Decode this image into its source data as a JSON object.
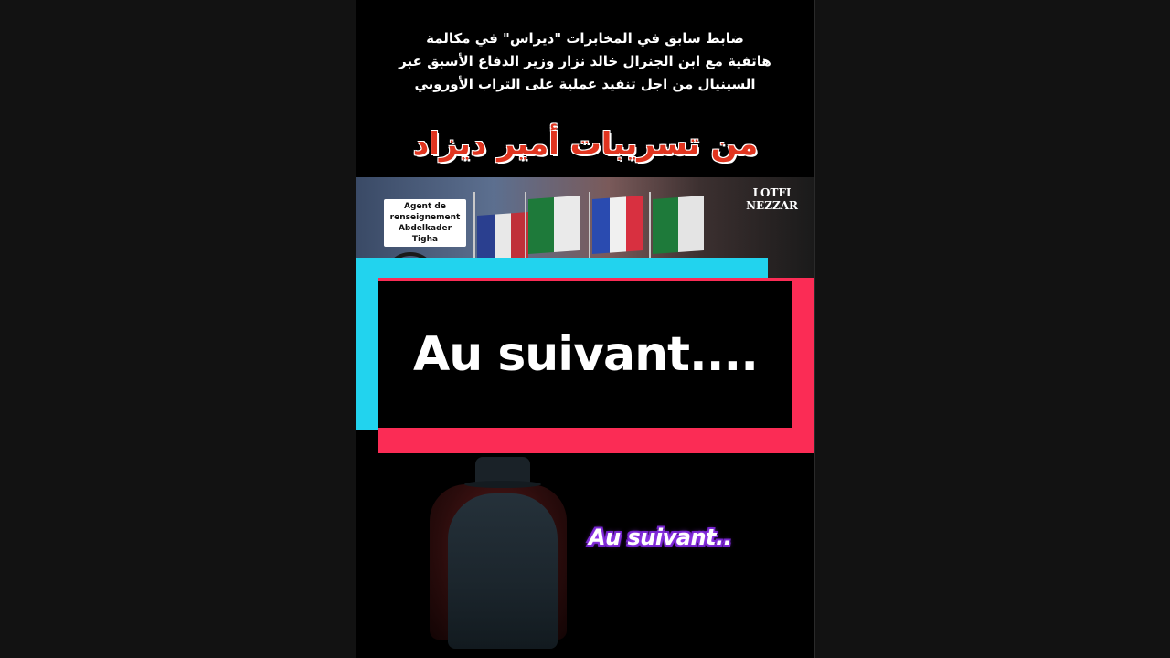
{
  "headline": {
    "line1": "ضابط سابق في المخابرات \"ديراس\" في مكالمة",
    "line2": "هاتفية  مع ابن الجنرال خالد نزار وزير الدفاع الأسبق عبر",
    "line3": "السينيال من اجل تنفيد عملية على التراب الأوروبي"
  },
  "red_title": "من تسريبات أمير ديزاد",
  "photo": {
    "badge_line1": "Agent de",
    "badge_line2": "renseignement",
    "badge_line3": "Abdelkader Tigha",
    "name_line1": "LOTFI",
    "name_line2": "NEZZAR"
  },
  "banner_text": "Au suivant....",
  "overlay_text": "Au suivant..",
  "colors": {
    "cyan": "#22d3ee",
    "pink": "#fb2c55",
    "title_red": "#e0341f",
    "glow_purple": "#9a3df0"
  }
}
